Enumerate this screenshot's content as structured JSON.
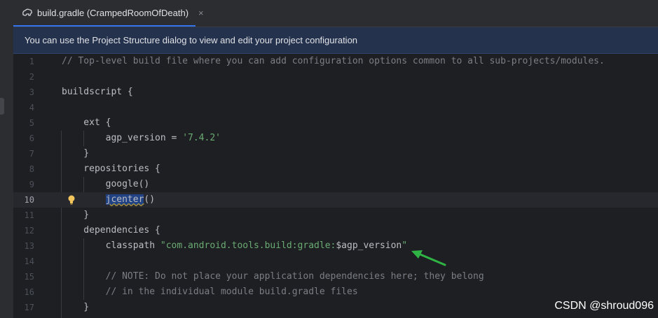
{
  "tab": {
    "icon": "gradle-elephant-icon",
    "label": "build.gradle (CrampedRoomOfDeath)",
    "close": "×"
  },
  "banner": {
    "text": "You can use the Project Structure dialog to view and edit your project configuration"
  },
  "editor": {
    "current_line": 10,
    "lines": [
      {
        "n": "1",
        "parts": [
          {
            "t": "// Top-level build file where you can add configuration options common to all sub-projects/modules.",
            "k": "comment"
          }
        ]
      },
      {
        "n": "2",
        "parts": []
      },
      {
        "n": "3",
        "parts": [
          {
            "t": "buildscript {",
            "k": "plain"
          }
        ]
      },
      {
        "n": "4",
        "parts": []
      },
      {
        "n": "5",
        "parts": [
          {
            "t": "    ext {",
            "k": "plain"
          }
        ]
      },
      {
        "n": "6",
        "parts": [
          {
            "t": "        agp_version = ",
            "k": "plain"
          },
          {
            "t": "'7.4.2'",
            "k": "string"
          }
        ]
      },
      {
        "n": "7",
        "parts": [
          {
            "t": "    }",
            "k": "plain"
          }
        ]
      },
      {
        "n": "8",
        "parts": [
          {
            "t": "    repositories {",
            "k": "plain"
          }
        ]
      },
      {
        "n": "9",
        "parts": [
          {
            "t": "        google()",
            "k": "plain"
          }
        ]
      },
      {
        "n": "10",
        "parts": [
          {
            "t": "        ",
            "k": "plain"
          },
          {
            "t": "jcenter",
            "k": "sel"
          },
          {
            "t": "()",
            "k": "plain"
          }
        ]
      },
      {
        "n": "11",
        "parts": [
          {
            "t": "    }",
            "k": "plain"
          }
        ]
      },
      {
        "n": "12",
        "parts": [
          {
            "t": "    dependencies {",
            "k": "plain"
          }
        ]
      },
      {
        "n": "13",
        "parts": [
          {
            "t": "        classpath ",
            "k": "plain"
          },
          {
            "t": "\"com.android.tools.build:gradle:",
            "k": "string"
          },
          {
            "t": "$agp_version",
            "k": "plain"
          },
          {
            "t": "\"",
            "k": "string"
          }
        ]
      },
      {
        "n": "14",
        "parts": []
      },
      {
        "n": "15",
        "parts": [
          {
            "t": "        // NOTE: Do not place your application dependencies here; they belong",
            "k": "comment"
          }
        ]
      },
      {
        "n": "16",
        "parts": [
          {
            "t": "        // in the individual module build.gradle files",
            "k": "comment"
          }
        ]
      },
      {
        "n": "17",
        "parts": [
          {
            "t": "    }",
            "k": "plain"
          }
        ]
      }
    ],
    "intention_icon": "lightbulb-icon",
    "annotation_icon": "green-arrow-icon"
  },
  "colors": {
    "comment": "#7a7e85",
    "string": "#6aab73",
    "plain": "#bcbec4",
    "banner_bg": "#25324d",
    "arrow": "#2fb344"
  },
  "watermark": "CSDN @shroud096"
}
